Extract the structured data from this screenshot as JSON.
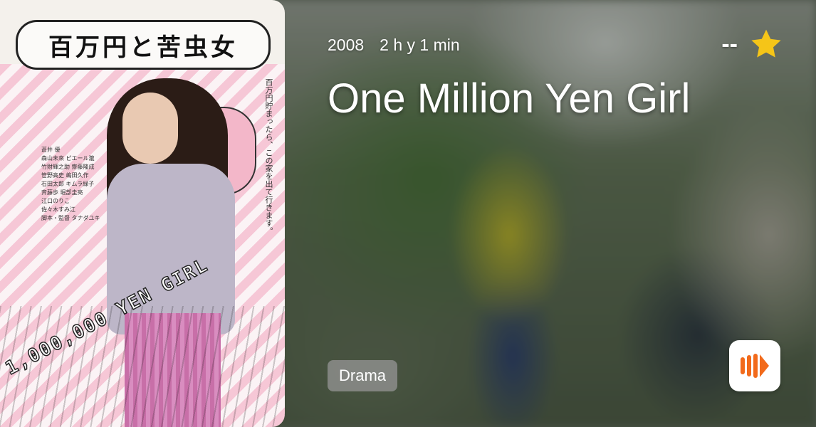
{
  "movie": {
    "year": "2008",
    "duration": "2 h y 1 min",
    "title": "One Million Yen Girl",
    "rating": "--",
    "genre": "Drama"
  },
  "poster": {
    "title_text": "百万円と苦虫女",
    "side_text": "百万円貯まったら、この家を出て行きます。",
    "credits": "蒼井 優\n森山未來 ピエール瀧\n竹財輝之助 齋藤隆成\n笹野高史 嶋田久作\n石田太郎 キムラ緑子\n斉藤歩 堀部圭亮\n江口のりこ\n佐々木すみ江\n脚本・監督 タナダユキ",
    "yen_text": "1,000,000 YEN GIRL"
  },
  "icons": {
    "star": "star-icon",
    "logo": "app-logo-icon"
  },
  "colors": {
    "star": "#F5C518",
    "logo_orange": "#F26A1B"
  }
}
